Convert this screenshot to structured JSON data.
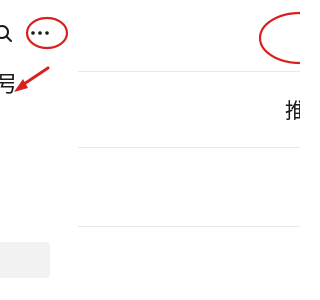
{
  "icons": {
    "search": "search-icon",
    "more": "more-horizontal-icon"
  },
  "left_panel": {
    "partial_label": "号"
  },
  "right_panel": {
    "partial_tab": "推"
  },
  "annotation_color": "#d9201e"
}
